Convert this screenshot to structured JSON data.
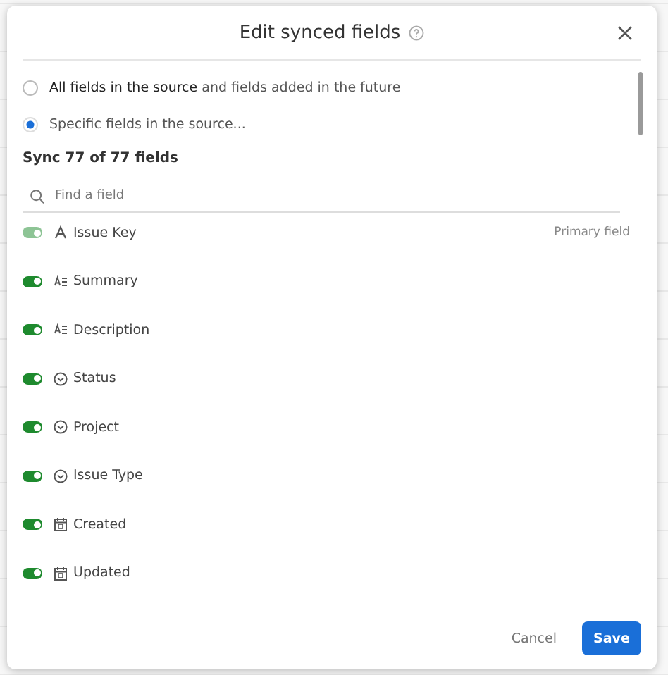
{
  "dialog": {
    "title": "Edit synced fields",
    "options": [
      {
        "label": "**All fields in the source** and fields added in the future",
        "selected": false
      },
      {
        "label": "Specific fields in the source...",
        "selected": true
      }
    ],
    "sync_count": "Sync 77 of 77 fields",
    "search": {
      "placeholder": "Find a field"
    },
    "fields": [
      {
        "name": "Issue Key",
        "kind": "text",
        "on": true,
        "disabled": true,
        "note": "Primary field"
      },
      {
        "name": "Summary",
        "kind": "longtext",
        "on": true,
        "disabled": false
      },
      {
        "name": "Description",
        "kind": "longtext",
        "on": true,
        "disabled": false
      },
      {
        "name": "Status",
        "kind": "select",
        "on": true,
        "disabled": false
      },
      {
        "name": "Project",
        "kind": "select",
        "on": true,
        "disabled": false
      },
      {
        "name": "Issue Type",
        "kind": "select",
        "on": true,
        "disabled": false
      },
      {
        "name": "Created",
        "kind": "date",
        "on": true,
        "disabled": false
      },
      {
        "name": "Updated",
        "kind": "date",
        "on": true,
        "disabled": false
      }
    ],
    "buttons": {
      "cancel": "Cancel",
      "save": "Save"
    }
  }
}
